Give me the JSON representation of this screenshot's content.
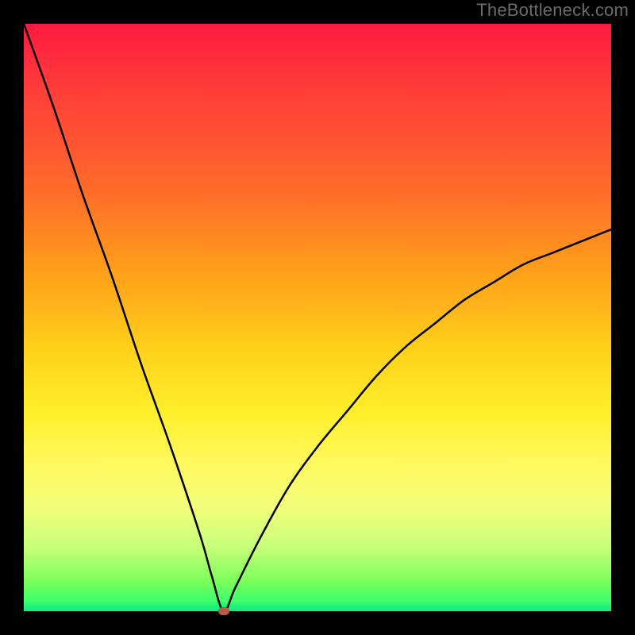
{
  "watermark": "TheBottleneck.com",
  "colors": {
    "frame_bg": "#000000",
    "curve_stroke": "#000000",
    "marker_fill": "#b95a4a",
    "gradient_stops": [
      "#ff1a3f",
      "#ff6a2a",
      "#ffcf1a",
      "#fff85a",
      "#c8ff7a",
      "#1aff7a"
    ]
  },
  "chart_data": {
    "type": "line",
    "title": "",
    "xlabel": "",
    "ylabel": "",
    "xlim": [
      0,
      100
    ],
    "ylim": [
      0,
      100
    ],
    "grid": false,
    "legend": false,
    "description": "Asymmetric V-shaped bottleneck curve where y≈0 at minimum (x≈34) rising steeply on left side to y≈100 at x≈0 and more gradually on right side toward y≈65 at x≈100.",
    "minimum": {
      "x": 34,
      "y": 0
    },
    "series": [
      {
        "name": "bottleneck",
        "x": [
          0,
          5,
          10,
          15,
          20,
          25,
          30,
          32,
          34,
          36,
          40,
          45,
          50,
          55,
          60,
          65,
          70,
          75,
          80,
          85,
          90,
          95,
          100
        ],
        "y": [
          100,
          86,
          71,
          57,
          42,
          28,
          13,
          6,
          0,
          4,
          12,
          21,
          28,
          34,
          40,
          45,
          49,
          53,
          56,
          59,
          61,
          63,
          65
        ]
      }
    ],
    "marker": {
      "x": 34,
      "y": 0,
      "shape": "rounded-rect",
      "color": "#b95a4a"
    }
  }
}
